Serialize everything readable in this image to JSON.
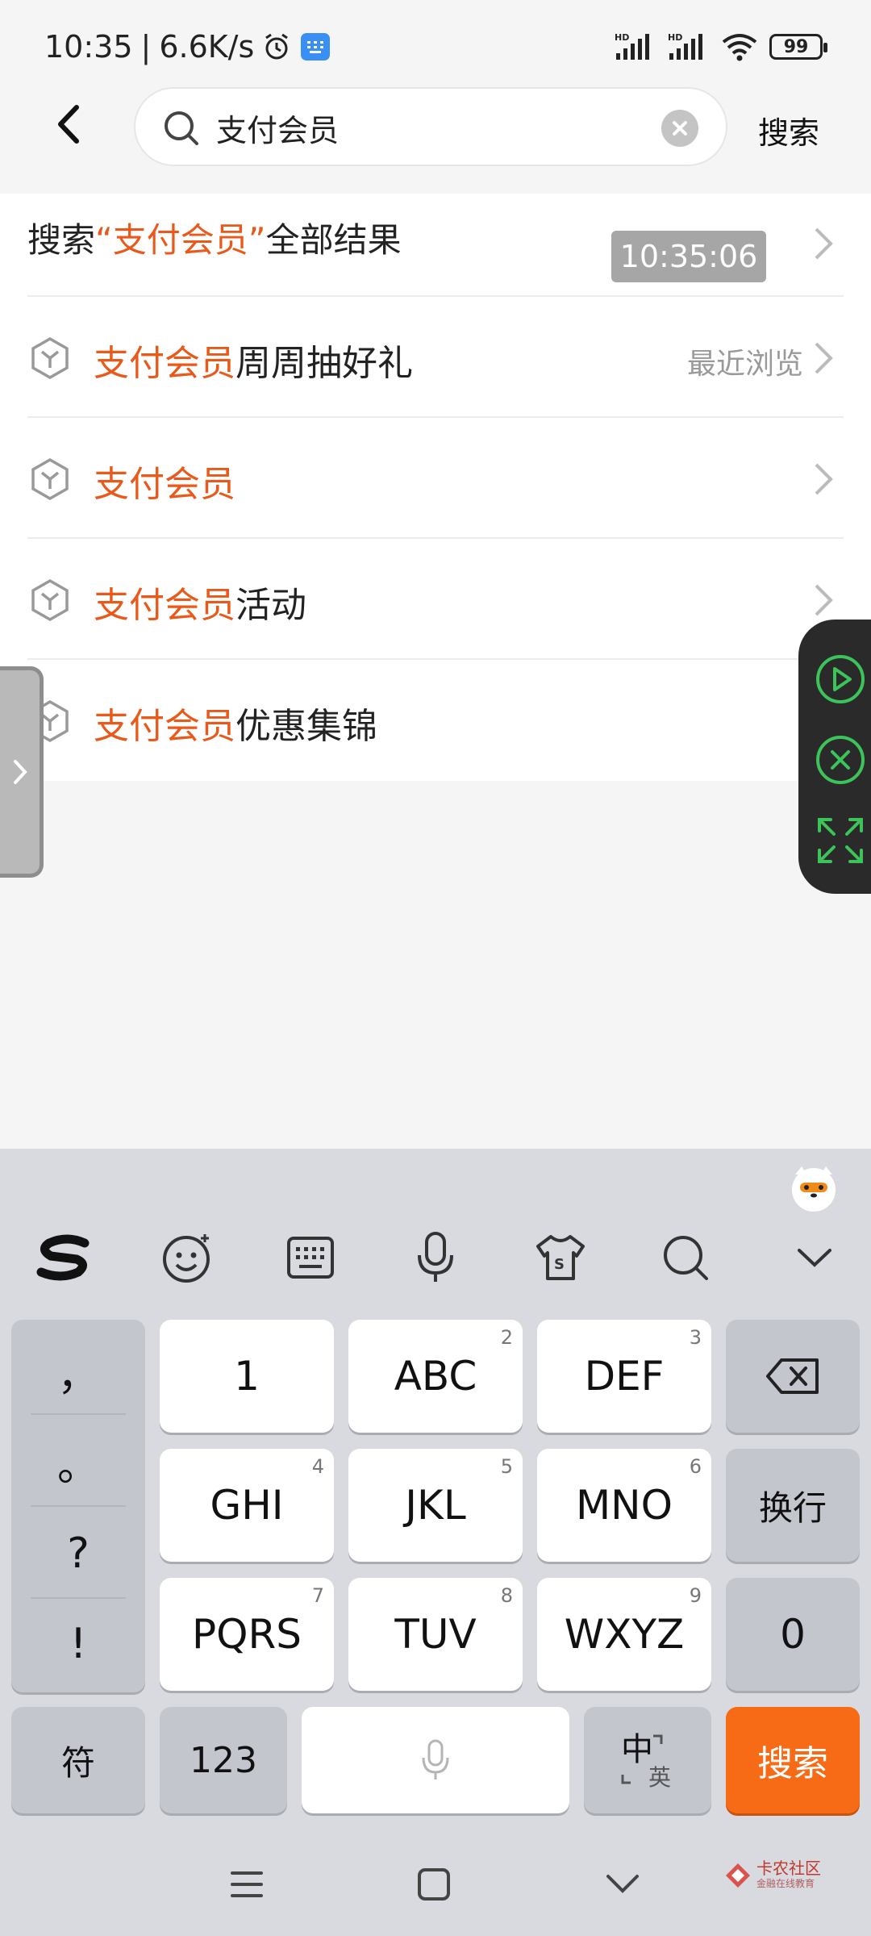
{
  "status_bar": {
    "time": "10:35",
    "network_speed": "6.6K/s",
    "battery": "99",
    "icons": [
      "alarm-icon",
      "app-notification-icon",
      "signal-hd-icon",
      "signal-hd-icon",
      "wifi-icon",
      "battery-icon"
    ]
  },
  "header": {
    "query": "支付会员",
    "search_label": "搜索"
  },
  "suggestions": {
    "all_results": {
      "prefix": "搜索",
      "open_quote": "“",
      "keyword": "支付会员",
      "close_quote": "”",
      "suffix": "全部结果"
    },
    "time_badge": "10:35:06",
    "items": [
      {
        "highlight": "支付会员",
        "rest": "周周抽好礼",
        "tag": "最近浏览"
      },
      {
        "highlight": "支付会员",
        "rest": "",
        "tag": ""
      },
      {
        "highlight": "支付会员",
        "rest": "活动",
        "tag": ""
      },
      {
        "highlight": "支付会员",
        "rest": "优惠集锦",
        "tag": ""
      }
    ]
  },
  "keyboard": {
    "toolbar_icons": [
      "sogou-logo-icon",
      "emoji-icon",
      "keyboard-icon",
      "microphone-icon",
      "skin-icon",
      "search-icon",
      "collapse-icon"
    ],
    "punctuation": [
      "，",
      "。",
      "?",
      "!"
    ],
    "keys": {
      "k1": {
        "main": "1",
        "sub": ""
      },
      "k2": {
        "main": "ABC",
        "sub": "2"
      },
      "k3": {
        "main": "DEF",
        "sub": "3"
      },
      "k4": {
        "main": "GHI",
        "sub": "4"
      },
      "k5": {
        "main": "JKL",
        "sub": "5"
      },
      "k6": {
        "main": "MNO",
        "sub": "6"
      },
      "k7": {
        "main": "PQRS",
        "sub": "7"
      },
      "k8": {
        "main": "TUV",
        "sub": "8"
      },
      "k9": {
        "main": "WXYZ",
        "sub": "9"
      },
      "k0": {
        "main": "0",
        "sub": ""
      }
    },
    "newline": "换行",
    "symbols": "符",
    "num_mode": "123",
    "lang_main": "中",
    "lang_sub": "英",
    "search": "搜索"
  },
  "watermark": {
    "text": "卡农社区",
    "sub": "金融在线教育"
  },
  "colors": {
    "highlight": "#e8591a",
    "search_key": "#f76b16",
    "float_green": "#3cc45a"
  }
}
